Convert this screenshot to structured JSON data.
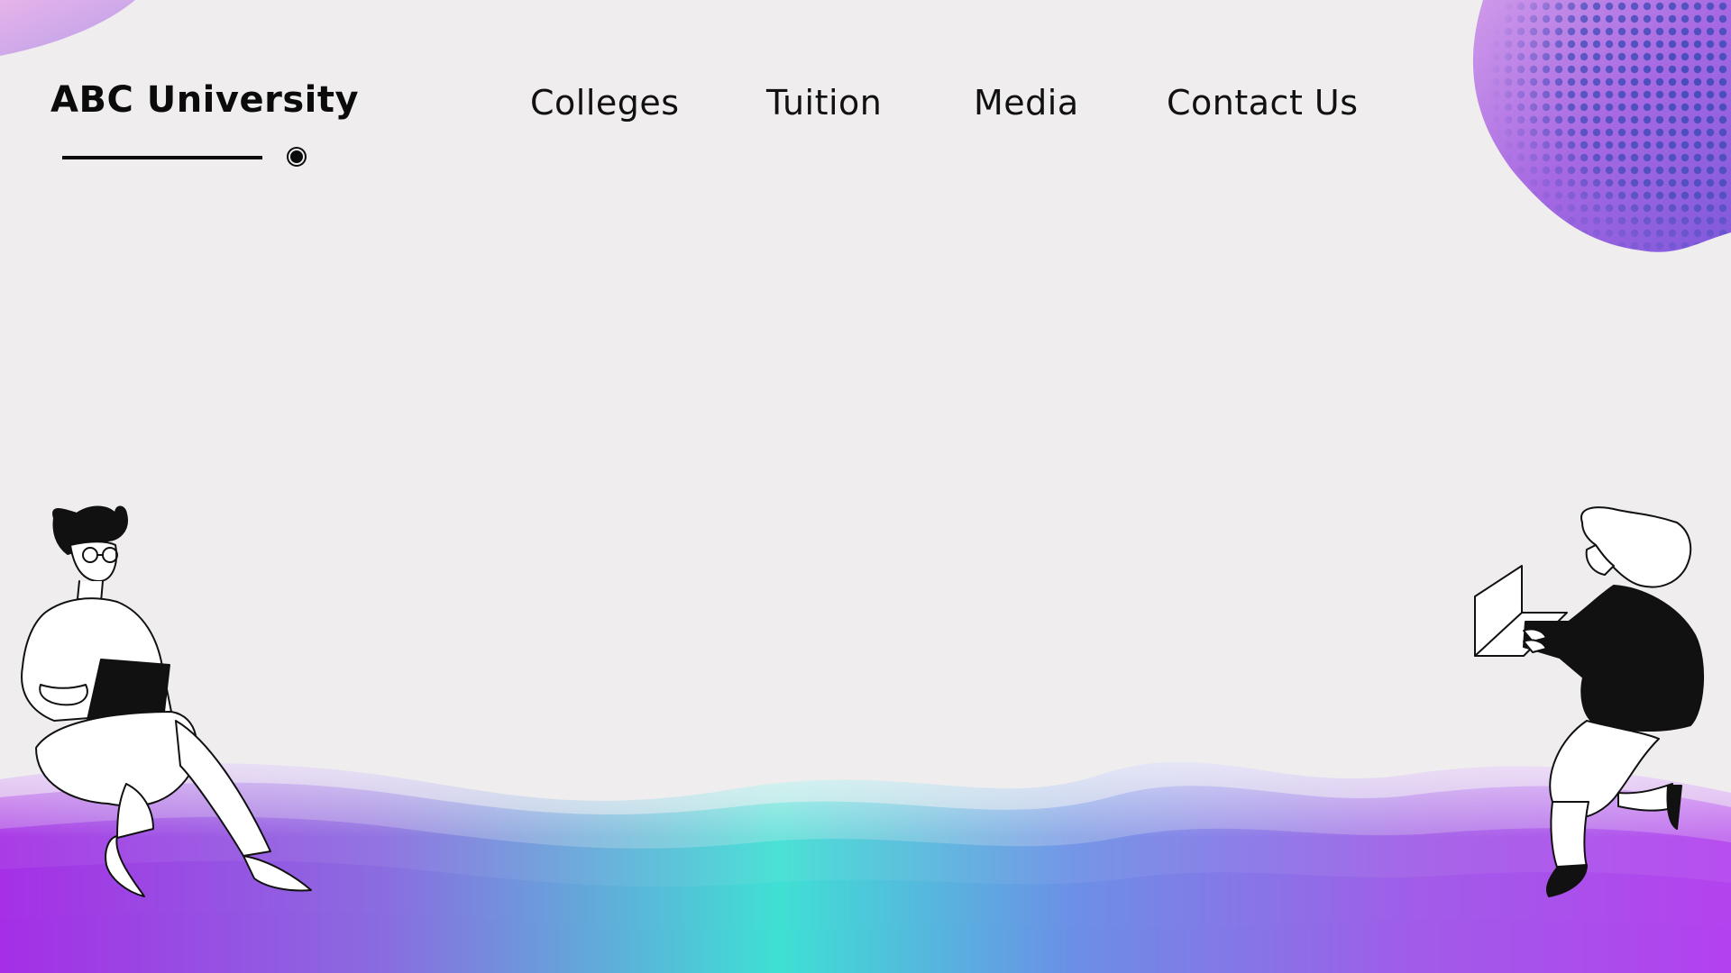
{
  "header": {
    "brand": "ABC University",
    "nav": [
      {
        "label": "Colleges"
      },
      {
        "label": "Tuition"
      },
      {
        "label": "Media"
      },
      {
        "label": "Contact Us"
      }
    ]
  },
  "colors": {
    "background": "#efedee",
    "text": "#0b0b0b",
    "accent_purple": "#a033e8",
    "accent_teal": "#3ee0d4",
    "accent_violet": "#7b3fd1"
  },
  "illustrations": {
    "left": "person-sitting-with-tablet",
    "right": "person-kneeling-with-laptop",
    "top_right": "halftone-blob",
    "bottom": "gradient-waves"
  }
}
